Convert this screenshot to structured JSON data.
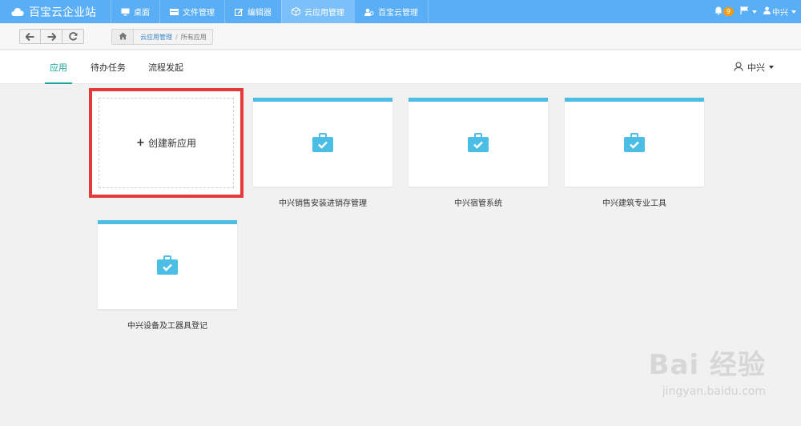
{
  "topbar": {
    "brand": "百宝云企业站",
    "nav": [
      {
        "label": "桌面",
        "icon": "monitor-icon"
      },
      {
        "label": "文件管理",
        "icon": "folder-icon"
      },
      {
        "label": "编辑器",
        "icon": "edit-icon"
      },
      {
        "label": "云应用管理",
        "icon": "cube-icon"
      },
      {
        "label": "百宝云管理",
        "icon": "users-icon"
      }
    ],
    "notification_count": "9",
    "user": "中兴",
    "accent_color": "#5aaef5"
  },
  "toolbar": {
    "breadcrumb": {
      "link": "云应用管理",
      "separator": "/",
      "current": "所有应用"
    }
  },
  "tabs": [
    {
      "label": "应用",
      "active": true
    },
    {
      "label": "待办任务",
      "active": false
    },
    {
      "label": "流程发起",
      "active": false
    }
  ],
  "user_menu": {
    "name": "中兴"
  },
  "create_card": {
    "label": "创建新应用",
    "highlight_color": "#e63a3a"
  },
  "apps": [
    {
      "name": "中兴销售安装进销存管理"
    },
    {
      "name": "中兴宿管系统"
    },
    {
      "name": "中兴建筑专业工具"
    },
    {
      "name": "中兴设备及工器具登记"
    }
  ],
  "watermark": {
    "brand": "Bai 经验",
    "url": "jingyan.baidu.com"
  }
}
